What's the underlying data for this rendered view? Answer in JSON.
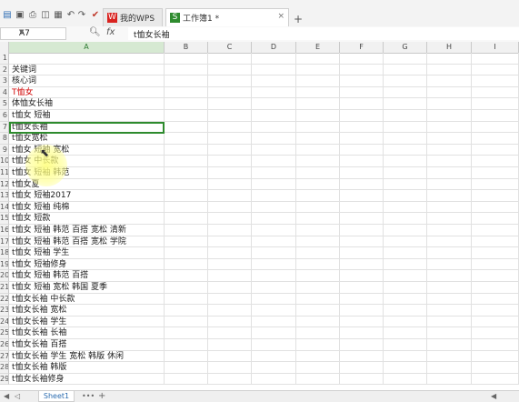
{
  "quick_toolbar": {
    "icons": [
      "file-menu-icon",
      "save-icon",
      "print-icon",
      "print-preview-icon",
      "export-pdf-icon",
      "undo-icon",
      "redo-icon",
      "format-painter-icon"
    ]
  },
  "tabs": [
    {
      "label": "我的WPS",
      "icon": "wps-logo-icon",
      "icon_color": "#d9221f"
    },
    {
      "label": "工作簿1 *",
      "icon": "spreadsheet-icon",
      "icon_color": "#2e8b2e"
    }
  ],
  "formula_bar": {
    "cell_ref": "A7",
    "fx_label": "fx",
    "content": "t恤女长袖"
  },
  "columns": [
    "A",
    "B",
    "C",
    "D",
    "E",
    "F",
    "G",
    "H",
    "I"
  ],
  "selected_column": "A",
  "rows": [
    {
      "num": "1",
      "a": ""
    },
    {
      "num": "2",
      "a": "关键词"
    },
    {
      "num": "3",
      "a": "核心词"
    },
    {
      "num": "4",
      "a": "T恤女",
      "color": "#d00000"
    },
    {
      "num": "5",
      "a": "体恤女长袖"
    },
    {
      "num": "6",
      "a": "t恤女 短袖"
    },
    {
      "num": "7",
      "a": "t恤女长袖"
    },
    {
      "num": "8",
      "a": "t恤女宽松"
    },
    {
      "num": "9",
      "a": "t恤女 短袖 宽松"
    },
    {
      "num": "10",
      "a": "t恤女 中长款"
    },
    {
      "num": "11",
      "a": "t恤女 短袖 韩范"
    },
    {
      "num": "12",
      "a": "t恤女夏"
    },
    {
      "num": "13",
      "a": "t恤女 短袖2017"
    },
    {
      "num": "14",
      "a": "t恤女 短袖 纯棉"
    },
    {
      "num": "15",
      "a": "t恤女 短款"
    },
    {
      "num": "16",
      "a": "t恤女 短袖 韩范 百搭 宽松 清新"
    },
    {
      "num": "17",
      "a": "t恤女 短袖 韩范 百搭 宽松 学院"
    },
    {
      "num": "18",
      "a": "t恤女 短袖 学生"
    },
    {
      "num": "19",
      "a": "t恤女 短袖修身"
    },
    {
      "num": "20",
      "a": "t恤女 短袖 韩范 百搭"
    },
    {
      "num": "21",
      "a": "t恤女 短袖 宽松 韩国 夏季"
    },
    {
      "num": "22",
      "a": "t恤女长袖 中长款"
    },
    {
      "num": "23",
      "a": "t恤女长袖 宽松"
    },
    {
      "num": "24",
      "a": "t恤女长袖 学生"
    },
    {
      "num": "25",
      "a": "t恤女长袖 长袖"
    },
    {
      "num": "26",
      "a": "t恤女长袖 百搭"
    },
    {
      "num": "27",
      "a": "t恤女长袖 学生 宽松 韩版 休闲"
    },
    {
      "num": "28",
      "a": "t恤女长袖 韩版"
    },
    {
      "num": "29",
      "a": "t恤女长袖修身"
    }
  ],
  "sheet_tabs": [
    "Sheet1"
  ],
  "sheet_add": "+"
}
